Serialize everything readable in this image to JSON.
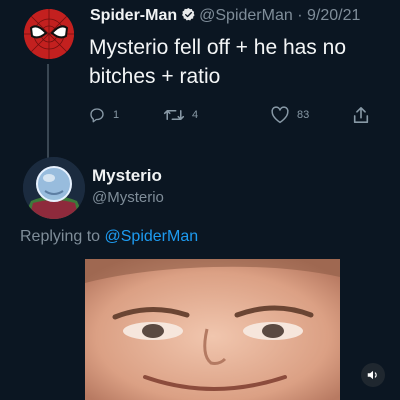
{
  "tweet": {
    "author_name": "Spider-Man",
    "author_handle": "@SpiderMan",
    "separator": "·",
    "date": "9/20/21",
    "text": "Mysterio fell off + he has no bitches + ratio",
    "reply_count": "1",
    "retweet_count": "4",
    "like_count": "83",
    "verified": true
  },
  "reply": {
    "author_name": "Mysterio",
    "author_handle": "@Mysterio",
    "replying_prefix": "Replying to",
    "replying_to": "@SpiderMan",
    "media": {
      "type": "image",
      "has_sound_toggle": true
    }
  },
  "colors": {
    "background": "#0b1622",
    "accent": "#1d9bf0",
    "muted_text": "#7f8d99",
    "verified_badge": "#1d9bf0",
    "spiderman_red": "#c3201f"
  },
  "icons": [
    "reply-icon",
    "retweet-icon",
    "like-icon",
    "share-icon",
    "verified-icon",
    "speaker-icon"
  ]
}
